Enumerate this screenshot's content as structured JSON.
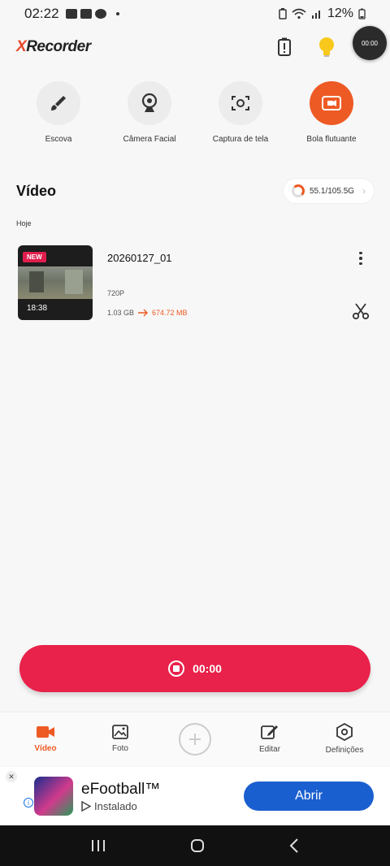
{
  "status_bar": {
    "time": "02:22",
    "battery": "12%"
  },
  "header": {
    "logo_prefix": "X",
    "logo_rest": "Recorder",
    "float_timer": "00:00"
  },
  "tools": [
    {
      "label": "Escova",
      "icon": "brush-icon"
    },
    {
      "label": "Câmera Facial",
      "icon": "webcam-icon"
    },
    {
      "label": "Captura de tela",
      "icon": "screenshot-icon"
    },
    {
      "label": "Bola flutuante",
      "icon": "floating-ball-icon"
    }
  ],
  "video_section": {
    "title": "Vídeo",
    "storage": "55.1/105.5G",
    "date_label": "Hoje"
  },
  "video": {
    "badge": "NEW",
    "duration": "18:38",
    "name": "20260127_01",
    "resolution": "720P",
    "size_from": "1.03 GB",
    "size_to": "674.72 MB"
  },
  "record": {
    "timer": "00:00"
  },
  "bottom_nav": [
    {
      "label": "Vídeo",
      "active": true
    },
    {
      "label": "Foto",
      "active": false
    },
    {
      "label": "",
      "active": false
    },
    {
      "label": "Editar",
      "active": false
    },
    {
      "label": "Definições",
      "active": false
    }
  ],
  "ad": {
    "title": "eFootball™",
    "subtitle": "Instalado",
    "button": "Abrir",
    "info": "i",
    "close": "✕"
  },
  "colors": {
    "accent": "#ee5a24",
    "record": "#e8224a",
    "ad_button": "#1a5fcf"
  }
}
